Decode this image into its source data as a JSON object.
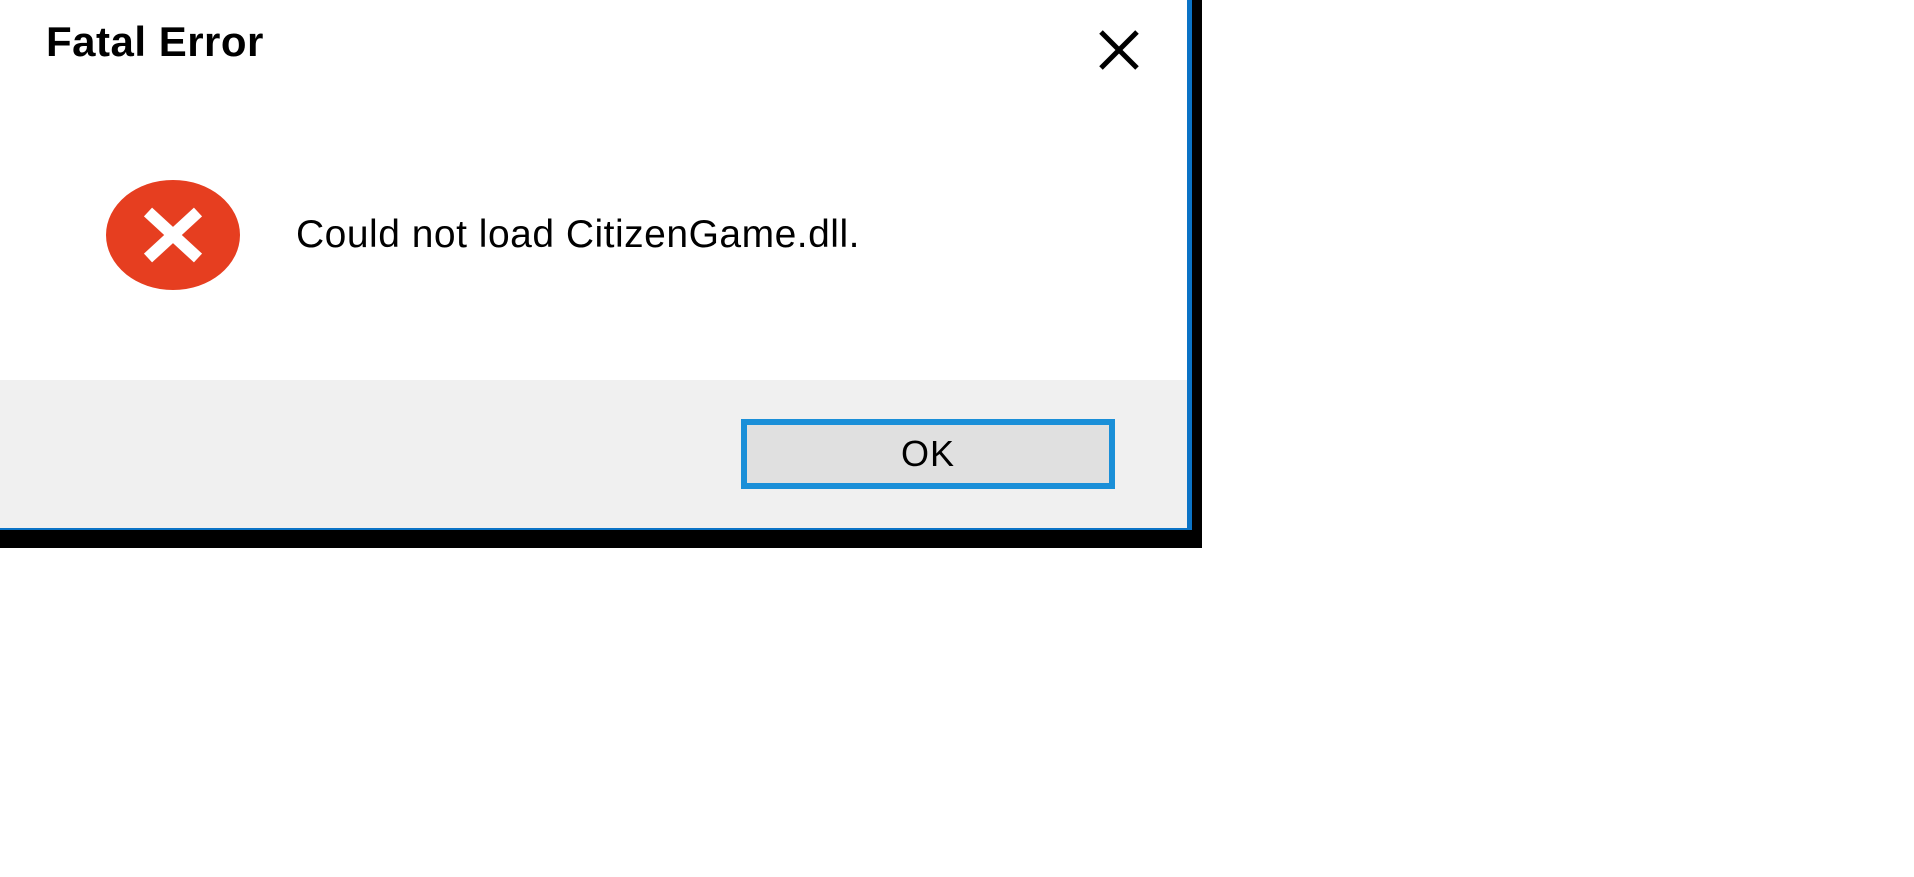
{
  "dialog": {
    "title": "Fatal Error",
    "message": "Could not load CitizenGame.dll.",
    "ok_button": "OK"
  },
  "icons": {
    "close": "close-icon",
    "error": "error-icon"
  },
  "colors": {
    "border_blue": "#0b73c6",
    "button_border_blue": "#1a8fd8",
    "error_red": "#e63e20",
    "button_bg": "#e0e0e0",
    "footer_bg": "#f0f0f0"
  }
}
